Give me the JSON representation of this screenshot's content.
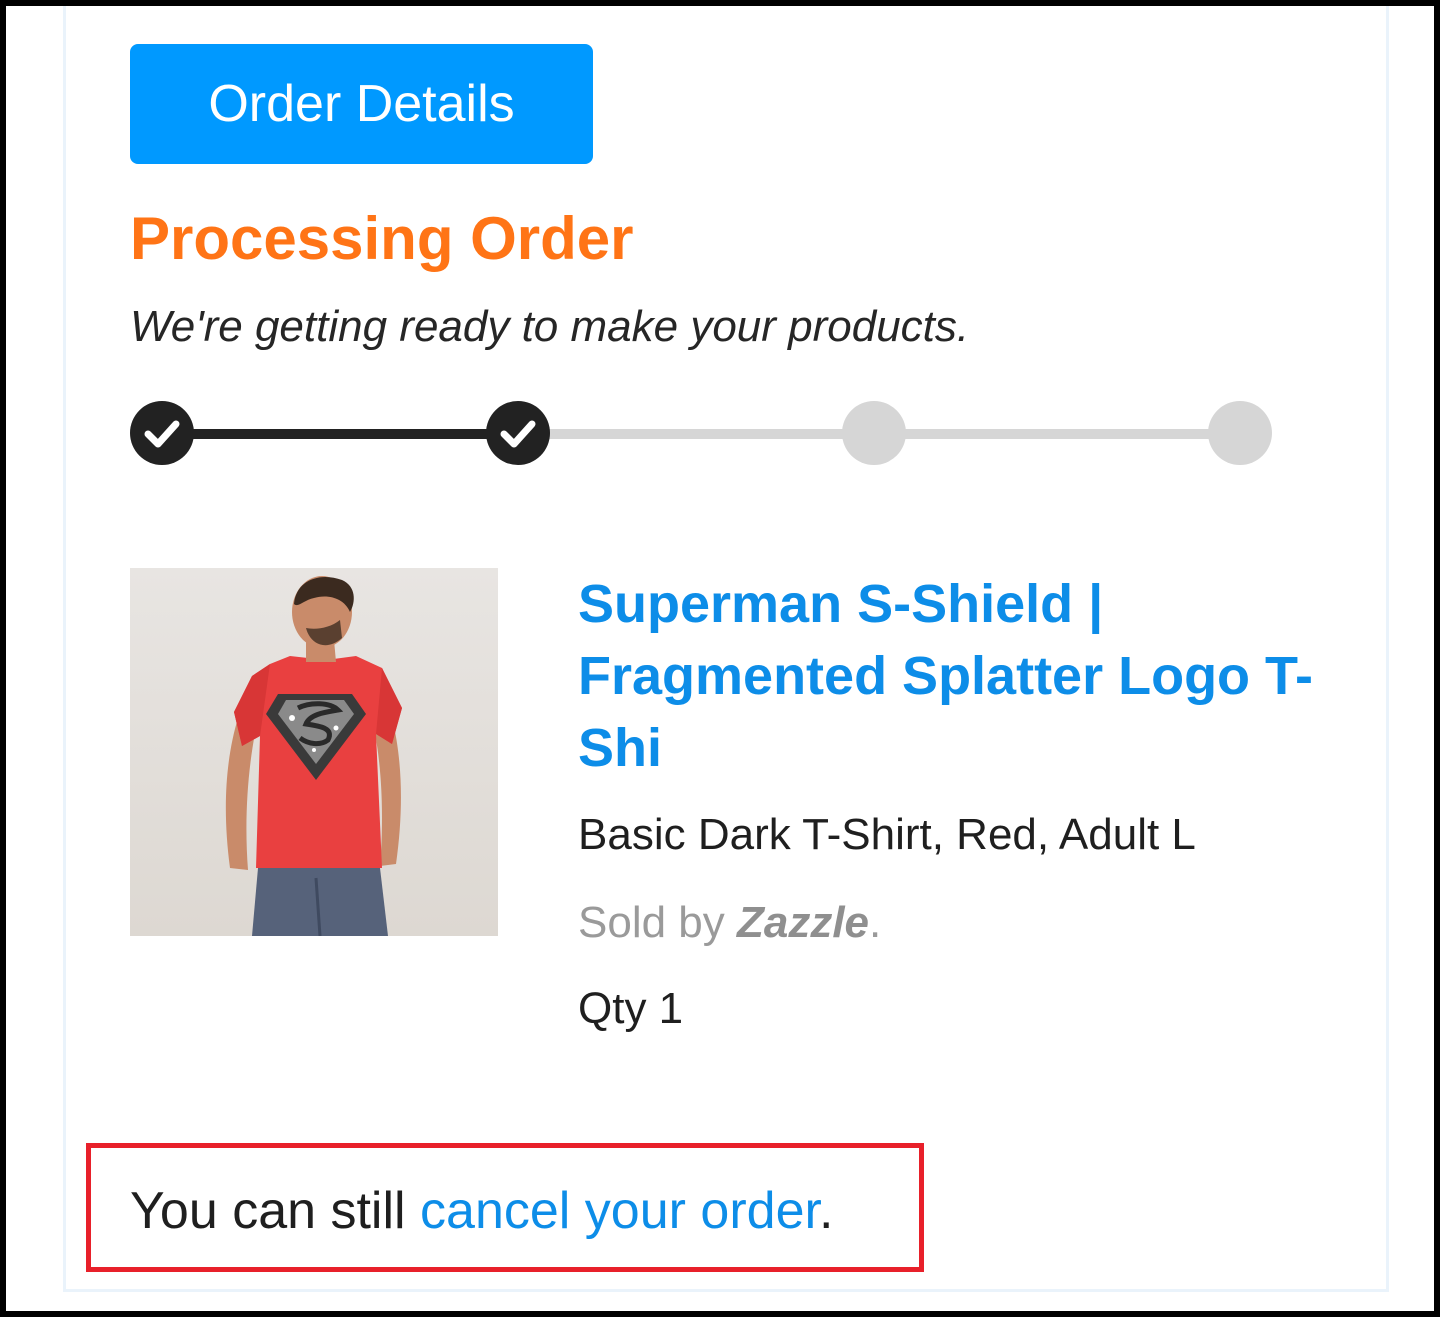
{
  "header": {
    "order_details_label": "Order Details"
  },
  "status": {
    "title": "Processing Order",
    "subtitle": "We're getting ready to make your products.",
    "progress": {
      "total_steps": 4,
      "completed_steps": 2
    },
    "colors": {
      "title": "#ff7416",
      "done": "#222222",
      "todo": "#d6d6d6"
    }
  },
  "product": {
    "title": "Superman S-Shield | Fragmented Splatter Logo T-Shi",
    "variant": "Basic Dark T-Shirt, Red, Adult L",
    "seller_prefix": "Sold by ",
    "seller_name": "Zazzle",
    "seller_suffix": ".",
    "qty_label": "Qty 1",
    "image_alt": "Man wearing red Superman T-shirt"
  },
  "cancel": {
    "prefix": "You can still ",
    "link_text": "cancel your order",
    "suffix": "."
  },
  "theme": {
    "accent": "#0099ff",
    "link": "#0d8de8",
    "highlight_border": "#e8202a"
  }
}
